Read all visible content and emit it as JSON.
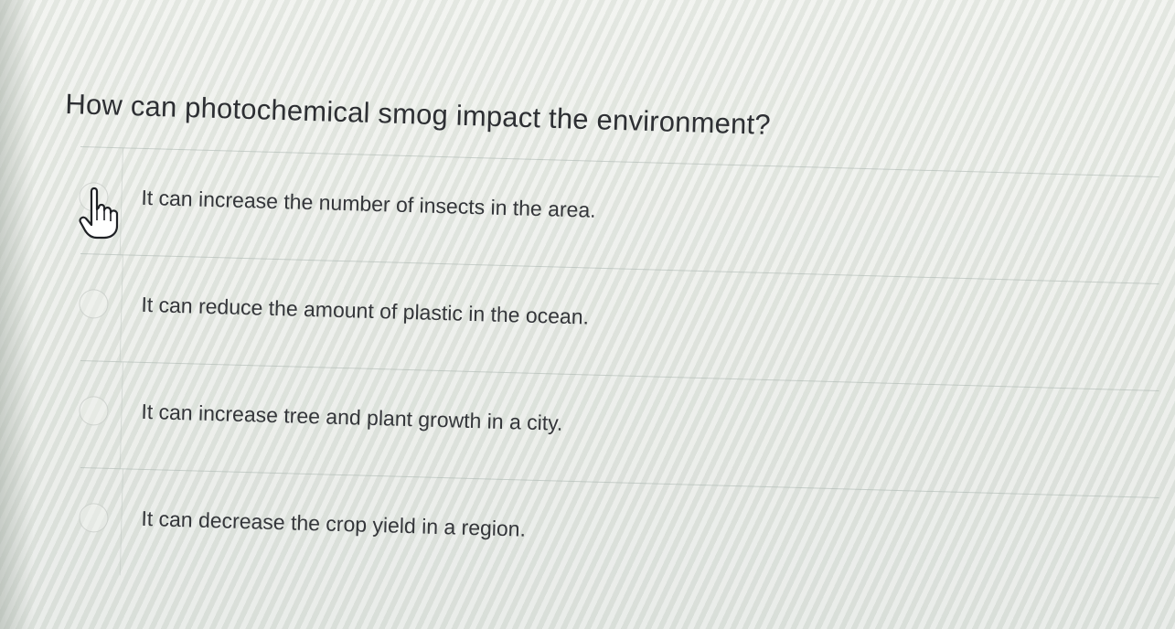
{
  "question": {
    "text": "How can photochemical smog impact the environment?"
  },
  "options": [
    {
      "label": "It can increase the number of insects in the area."
    },
    {
      "label": "It can reduce the amount of plastic in the ocean."
    },
    {
      "label": "It can increase tree and plant growth in a city."
    },
    {
      "label": "It can decrease the crop yield in a region."
    }
  ],
  "cursor": {
    "icon": "hand-pointer-icon"
  }
}
